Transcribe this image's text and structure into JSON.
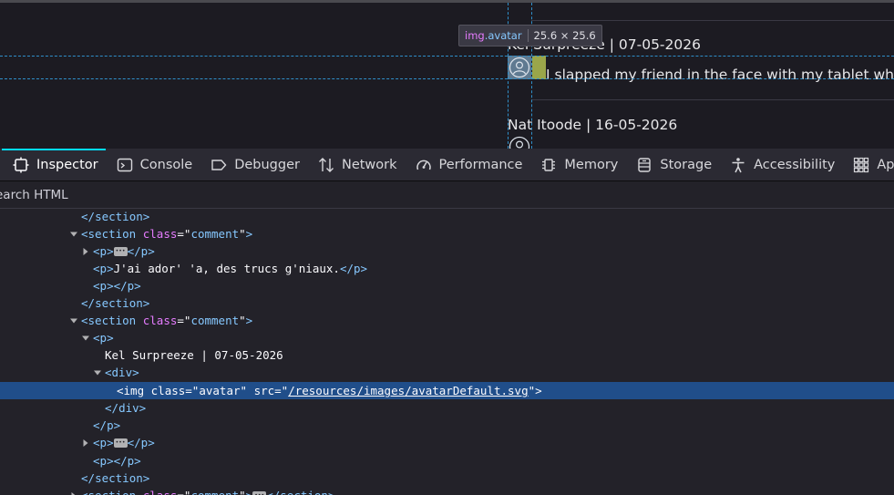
{
  "viewport": {
    "tooltip": {
      "tag": "img",
      "class": ".avatar",
      "dimensions": "25.6 × 25.6"
    },
    "comment1_header": "Kel Surpreeze | 07-05-2026",
    "comment1_body": "I slapped my friend in the face with my tablet while you",
    "comment2_header": "Nat Itoode | 16-05-2026"
  },
  "toolbar": {
    "tabs": [
      {
        "label": "Inspector",
        "icon": "inspector-icon"
      },
      {
        "label": "Console",
        "icon": "console-icon"
      },
      {
        "label": "Debugger",
        "icon": "debugger-icon"
      },
      {
        "label": "Network",
        "icon": "network-icon"
      },
      {
        "label": "Performance",
        "icon": "performance-icon"
      },
      {
        "label": "Memory",
        "icon": "memory-icon"
      },
      {
        "label": "Storage",
        "icon": "storage-icon"
      },
      {
        "label": "Accessibility",
        "icon": "accessibility-icon"
      },
      {
        "label": "App",
        "icon": "application-icon"
      }
    ],
    "active_tab": "Inspector"
  },
  "search": {
    "placeholder": "earch HTML",
    "value": ""
  },
  "tree": {
    "rows": {
      "r0": {
        "close_section": "section"
      },
      "r1": {
        "tag": "section",
        "attr": "class",
        "val": "comment"
      },
      "r2": {
        "tag": "p",
        "close": "p"
      },
      "r3": {
        "tag": "p",
        "text": "J'ai ador' 'a, des trucs g'niaux.",
        "close": "p"
      },
      "r4": {
        "tag": "p",
        "close": "p"
      },
      "r5": {
        "close_section": "section"
      },
      "r6": {
        "tag": "section",
        "attr": "class",
        "val": "comment"
      },
      "r7": {
        "tag": "p"
      },
      "r8": {
        "text": "Kel Surpreeze | 07-05-2026"
      },
      "r9": {
        "tag": "div"
      },
      "r10": {
        "tag": "img",
        "attr1": "class",
        "val1": "avatar",
        "attr2": "src",
        "val2": "/resources/images/avatarDefault.svg"
      },
      "r11": {
        "close": "div"
      },
      "r12": {
        "close": "p"
      },
      "r13": {
        "tag": "p",
        "close": "p"
      },
      "r14": {
        "tag": "p",
        "close": "p"
      },
      "r15": {
        "close_section": "section"
      },
      "r16": {
        "tag": "section",
        "attr": "class",
        "val": "comment",
        "close": "section"
      }
    }
  },
  "colors": {
    "selection": "#204e8a",
    "tag": "#86c8ff",
    "attribute": "#e67cff",
    "active_tab_indicator": "#00ddff",
    "guide": "#2f8fc9"
  }
}
